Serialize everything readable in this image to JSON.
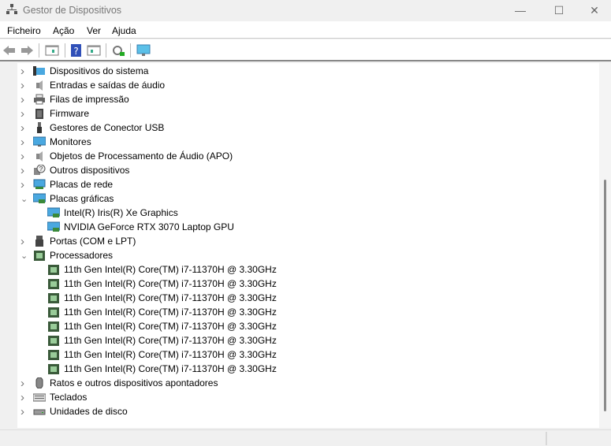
{
  "window": {
    "title": "Gestor de Dispositivos",
    "minimize": "—",
    "maximize": "☐",
    "close": "✕"
  },
  "menu": [
    "Ficheiro",
    "Ação",
    "Ver",
    "Ajuda"
  ],
  "tree": [
    {
      "label": "Dispositivos do sistema",
      "icon": "system-devices-icon",
      "state": "collapsed",
      "level": 0
    },
    {
      "label": "Entradas e saídas de áudio",
      "icon": "speaker-icon",
      "state": "collapsed",
      "level": 0
    },
    {
      "label": "Filas de impressão",
      "icon": "printer-icon",
      "state": "collapsed",
      "level": 0
    },
    {
      "label": "Firmware",
      "icon": "firmware-icon",
      "state": "collapsed",
      "level": 0
    },
    {
      "label": "Gestores de Conector USB",
      "icon": "usb-icon",
      "state": "collapsed",
      "level": 0
    },
    {
      "label": "Monitores",
      "icon": "monitor-icon",
      "state": "collapsed",
      "level": 0
    },
    {
      "label": "Objetos de Processamento de Áudio (APO)",
      "icon": "speaker-icon",
      "state": "collapsed",
      "level": 0
    },
    {
      "label": "Outros dispositivos",
      "icon": "unknown-device-icon",
      "state": "collapsed",
      "level": 0
    },
    {
      "label": "Placas de rede",
      "icon": "network-icon",
      "state": "collapsed",
      "level": 0
    },
    {
      "label": "Placas gráficas",
      "icon": "display-adapter-icon",
      "state": "expanded",
      "level": 0
    },
    {
      "label": "Intel(R) Iris(R) Xe Graphics",
      "icon": "display-adapter-icon",
      "level": 1
    },
    {
      "label": "NVIDIA GeForce RTX 3070 Laptop GPU",
      "icon": "display-adapter-icon",
      "level": 1
    },
    {
      "label": "Portas (COM e LPT)",
      "icon": "port-icon",
      "state": "collapsed",
      "level": 0
    },
    {
      "label": "Processadores",
      "icon": "processor-icon",
      "state": "expanded",
      "level": 0
    },
    {
      "label": "11th Gen Intel(R) Core(TM) i7-11370H @ 3.30GHz",
      "icon": "processor-icon",
      "level": 1
    },
    {
      "label": "11th Gen Intel(R) Core(TM) i7-11370H @ 3.30GHz",
      "icon": "processor-icon",
      "level": 1
    },
    {
      "label": "11th Gen Intel(R) Core(TM) i7-11370H @ 3.30GHz",
      "icon": "processor-icon",
      "level": 1
    },
    {
      "label": "11th Gen Intel(R) Core(TM) i7-11370H @ 3.30GHz",
      "icon": "processor-icon",
      "level": 1
    },
    {
      "label": "11th Gen Intel(R) Core(TM) i7-11370H @ 3.30GHz",
      "icon": "processor-icon",
      "level": 1
    },
    {
      "label": "11th Gen Intel(R) Core(TM) i7-11370H @ 3.30GHz",
      "icon": "processor-icon",
      "level": 1
    },
    {
      "label": "11th Gen Intel(R) Core(TM) i7-11370H @ 3.30GHz",
      "icon": "processor-icon",
      "level": 1
    },
    {
      "label": "11th Gen Intel(R) Core(TM) i7-11370H @ 3.30GHz",
      "icon": "processor-icon",
      "level": 1
    },
    {
      "label": "Ratos e outros dispositivos apontadores",
      "icon": "mouse-icon",
      "state": "collapsed",
      "level": 0
    },
    {
      "label": "Teclados",
      "icon": "keyboard-icon",
      "state": "collapsed",
      "level": 0
    },
    {
      "label": "Unidades de disco",
      "icon": "disk-icon",
      "state": "collapsed",
      "level": 0
    }
  ]
}
